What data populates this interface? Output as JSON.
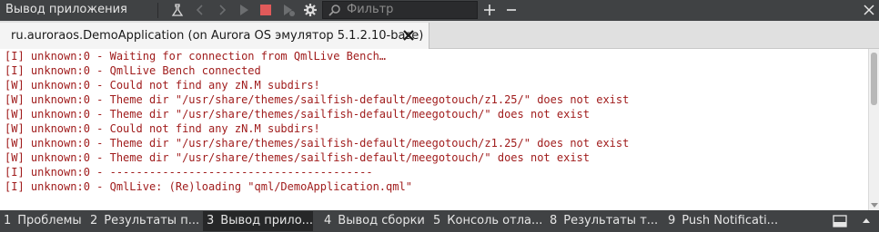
{
  "toolbar": {
    "title": "Вывод приложения",
    "filter_placeholder": "Фильтр"
  },
  "tab": {
    "label": "ru.auroraos.DemoApplication (on Aurora OS эмулятор 5.1.2.10-base)"
  },
  "output": {
    "lines": [
      "[I] unknown:0 - Waiting for connection from QmlLive Bench…",
      "[I] unknown:0 - QmlLive Bench connected",
      "[W] unknown:0 - Could not find any zN.M subdirs!",
      "[W] unknown:0 - Theme dir \"/usr/share/themes/sailfish-default/meegotouch/z1.25/\" does not exist",
      "[W] unknown:0 - Theme dir \"/usr/share/themes/sailfish-default/meegotouch/\" does not exist",
      "[W] unknown:0 - Could not find any zN.M subdirs!",
      "[W] unknown:0 - Theme dir \"/usr/share/themes/sailfish-default/meegotouch/z1.25/\" does not exist",
      "[W] unknown:0 - Theme dir \"/usr/share/themes/sailfish-default/meegotouch/\" does not exist",
      "[I] unknown:0 - ----------------------------------------",
      "[I] unknown:0 - QmlLive: (Re)loading \"qml/DemoApplication.qml\""
    ],
    "text_color": "#a01c1c"
  },
  "bottom_tabs": [
    {
      "num": "1",
      "label": "Проблемы",
      "active": false
    },
    {
      "num": "2",
      "label": "Результаты п...",
      "active": false
    },
    {
      "num": "3",
      "label": "Вывод прило...",
      "active": true
    },
    {
      "num": "4",
      "label": "Вывод сборки",
      "active": false
    },
    {
      "num": "5",
      "label": "Консоль отла...",
      "active": false
    },
    {
      "num": "8",
      "label": "Результаты т...",
      "active": false
    },
    {
      "num": "9",
      "label": "Push Notificati...",
      "active": false
    }
  ],
  "colors": {
    "toolbar_bg": "#404244",
    "stop_icon": "#e05a5a",
    "output_bg": "#ffffff"
  },
  "icons": [
    "run-settings-icon",
    "back-icon",
    "forward-icon",
    "run-icon",
    "stop-icon",
    "debug-run-icon",
    "settings-gear-icon",
    "search-icon",
    "add-icon",
    "minimize-icon",
    "close-icon",
    "hide-panel-icon",
    "maximize-panel-icon"
  ]
}
